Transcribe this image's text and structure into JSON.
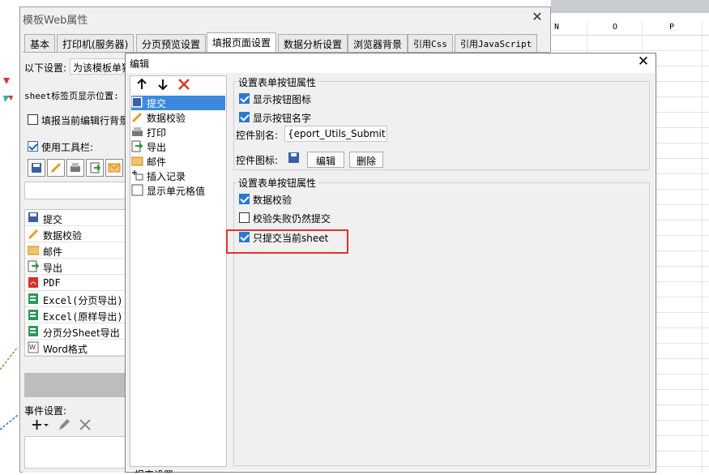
{
  "sheet": {
    "columns": [
      "N",
      "O",
      "P"
    ]
  },
  "outer_dialog": {
    "title": "模板Web属性",
    "close_label": "✕",
    "tabs": [
      "基本",
      "打印机(服务器)",
      "分页预览设置",
      "填报页面设置",
      "数据分析设置",
      "浏览器背景",
      "引用Css",
      "引用JavaScript"
    ],
    "active_tab": "填报页面设置",
    "settings_label": "以下设置:",
    "settings_value": "为该模板单独",
    "sheet_label_position": "sheet标签页显示位置:",
    "fill_current_row_bg": "填报当前编辑行背景",
    "use_toolbar": "使用工具栏:",
    "buttons": [
      {
        "icon": "save-icon",
        "label": "提交"
      },
      {
        "icon": "pencil-icon",
        "label": "数据校验"
      },
      {
        "icon": "mail-icon",
        "label": "邮件"
      },
      {
        "icon": "export-icon",
        "label": "导出"
      },
      {
        "icon": "pdf-icon",
        "label": "PDF"
      },
      {
        "icon": "excel-icon",
        "label": "Excel(分页导出)"
      },
      {
        "icon": "excel-icon",
        "label": "Excel(原样导出)"
      },
      {
        "icon": "excel-icon",
        "label": "分页分Sheet导出"
      },
      {
        "icon": "word-icon",
        "label": "Word格式"
      }
    ],
    "event_settings": "事件设置:",
    "bottom_cut_label": "报表设置"
  },
  "edit_dialog": {
    "title": "编辑",
    "close_label": "✕",
    "items": [
      {
        "icon": "save-icon",
        "label": "提交"
      },
      {
        "icon": "pencil-icon",
        "label": "数据校验"
      },
      {
        "icon": "print-icon",
        "label": "打印"
      },
      {
        "icon": "export-icon",
        "label": "导出"
      },
      {
        "icon": "mail-icon",
        "label": "邮件"
      },
      {
        "icon": "insert-record-icon",
        "label": "插入记录"
      },
      {
        "icon": "cell-value-icon",
        "label": "显示单元格值"
      }
    ],
    "selected_item": "提交",
    "form_button_props": {
      "title": "设置表单按钮属性",
      "show_icon": "显示按钮图标",
      "show_name": "显示按钮名字",
      "alias_label": "控件别名:",
      "alias_value": "{eport_Utils_Submit}}",
      "icon_label": "控件图标:",
      "edit_button": "编辑",
      "delete_button": "删除"
    },
    "form_button_props2": {
      "title": "设置表单按钮属性",
      "data_validation": "数据校验",
      "submit_on_fail": "校验失败仍然提交",
      "submit_current_sheet": "只提交当前sheet"
    }
  },
  "colors": {
    "highlight": "#e0332d",
    "selection": "#3b8ae0",
    "checkbox_blue": "#2a78d4"
  }
}
